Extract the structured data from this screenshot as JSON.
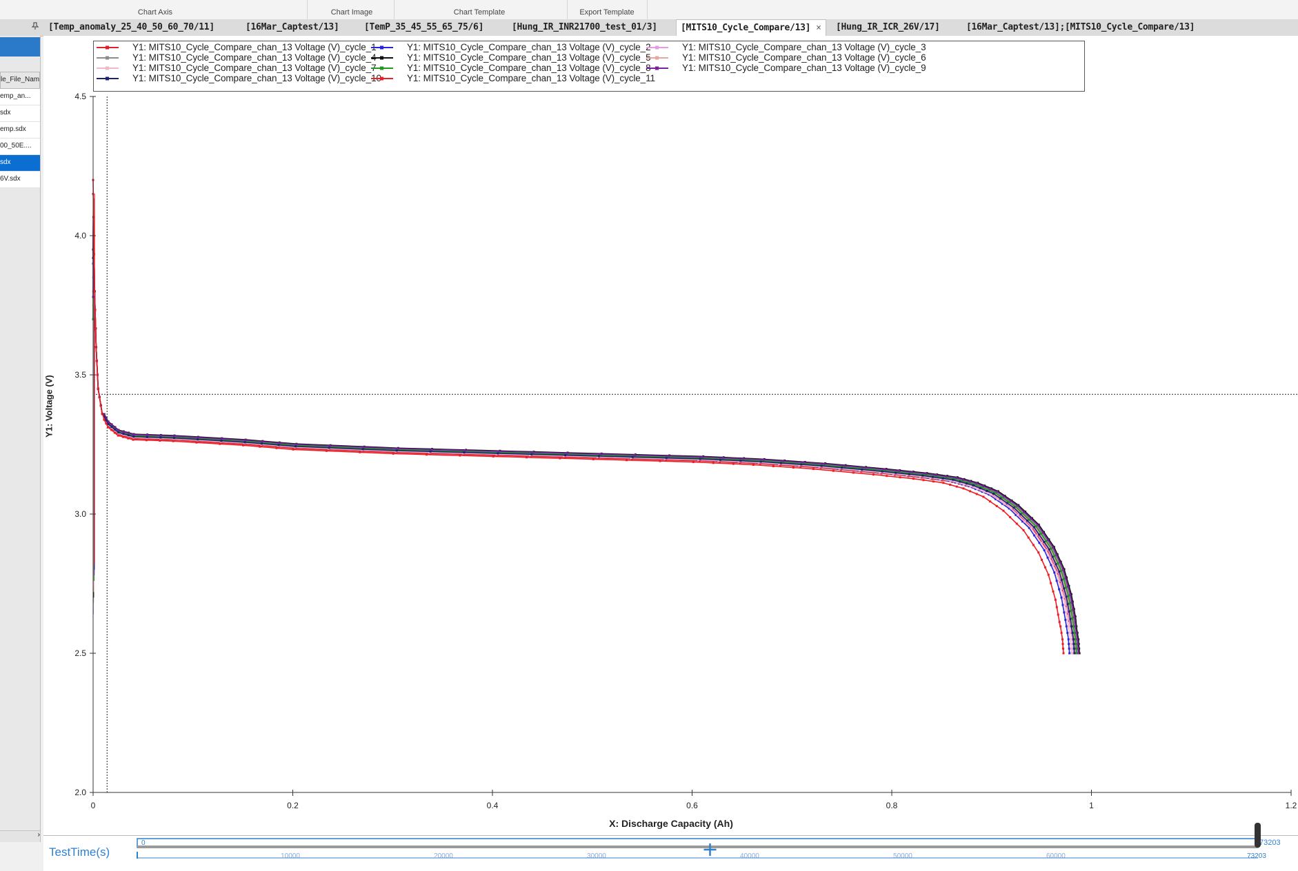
{
  "ribbon": {
    "groups": [
      "Chart Axis",
      "Chart Image",
      "Chart Template",
      "Export Template"
    ]
  },
  "tabs": [
    {
      "label": "[Temp_anomaly_25_40_50_60_70/11]"
    },
    {
      "label": "[16Mar_Captest/13]"
    },
    {
      "label": "[TemP_35_45_55_65_75/6]"
    },
    {
      "label": "[Hung_IR_INR21700_test_01/3]"
    },
    {
      "label": "[MITS10_Cycle_Compare/13]",
      "active": true,
      "close": "×"
    },
    {
      "label": "[Hung_IR_ICR_26V/17]"
    },
    {
      "label": "[16Mar_Captest/13];[MITS10_Cycle_Compare/13]"
    }
  ],
  "sidebar": {
    "pin_icon": "pin-icon",
    "header": "le_File_Nam",
    "rows": [
      "emp_an...",
      "sdx",
      "emp.sdx",
      "00_50E....",
      "sdx",
      "6V.sdx"
    ],
    "selected_index": 4,
    "scroll_arrow": "›"
  },
  "chart_data": {
    "type": "line",
    "xlabel": "X: Discharge Capacity (Ah)",
    "ylabel": "Y1: Voltage (V)",
    "xlim": [
      0,
      1.2
    ],
    "ylim": [
      2.0,
      4.5
    ],
    "xticks": [
      0,
      0.2,
      0.4,
      0.6,
      0.8,
      1,
      1.2
    ],
    "xtick_labels": [
      "0",
      "0.2",
      "0.4",
      "0.6",
      "0.8",
      "1",
      "1.2"
    ],
    "yticks": [
      2.0,
      2.5,
      3.0,
      3.5,
      4.0,
      4.5
    ],
    "ytick_labels": [
      "2.0",
      "2.5",
      "3.0",
      "3.5",
      "4.0",
      "4.5"
    ],
    "crosshair": {
      "x": 0.014,
      "y": 3.43
    },
    "legend_position": "top",
    "series": [
      {
        "name": "Y1: MITS10_Cycle_Compare_chan_13 Voltage (V)_cycle_1",
        "color": "#e0202a",
        "cap": 0.982
      },
      {
        "name": "Y1: MITS10_Cycle_Compare_chan_13 Voltage (V)_cycle_2",
        "color": "#2424e0",
        "cap": 0.978
      },
      {
        "name": "Y1: MITS10_Cycle_Compare_chan_13 Voltage (V)_cycle_3",
        "color": "#e39be3",
        "cap": 0.982
      },
      {
        "name": "Y1: MITS10_Cycle_Compare_chan_13 Voltage (V)_cycle_4",
        "color": "#8c8c8c",
        "cap": 0.986
      },
      {
        "name": "Y1: MITS10_Cycle_Compare_chan_13 Voltage (V)_cycle_5",
        "color": "#111111",
        "cap": 0.988
      },
      {
        "name": "Y1: MITS10_Cycle_Compare_chan_13 Voltage (V)_cycle_6",
        "color": "#e8a6a0",
        "cap": 0.984
      },
      {
        "name": "Y1: MITS10_Cycle_Compare_chan_13 Voltage (V)_cycle_7",
        "color": "#f2b8c6",
        "cap": 0.98
      },
      {
        "name": "Y1: MITS10_Cycle_Compare_chan_13 Voltage (V)_cycle_8",
        "color": "#1f9a1f",
        "cap": 0.985
      },
      {
        "name": "Y1: MITS10_Cycle_Compare_chan_13 Voltage (V)_cycle_9",
        "color": "#7a1fa0",
        "cap": 0.987
      },
      {
        "name": "Y1: MITS10_Cycle_Compare_chan_13 Voltage (V)_cycle_10",
        "color": "#1b2470",
        "cap": 0.983
      },
      {
        "name": "Y1: MITS10_Cycle_Compare_chan_13 Voltage (V)_cycle_11",
        "color": "#ee1c24",
        "cap": 0.972
      }
    ]
  },
  "time_slider": {
    "label": "TestTime(s)",
    "min": "0",
    "max": "73203",
    "ticks": [
      "10000",
      "20000",
      "30000",
      "40000",
      "50000",
      "60000"
    ],
    "range_max": 73203,
    "bottom_end": "73203",
    "thumb_icon": "plus-icon"
  }
}
